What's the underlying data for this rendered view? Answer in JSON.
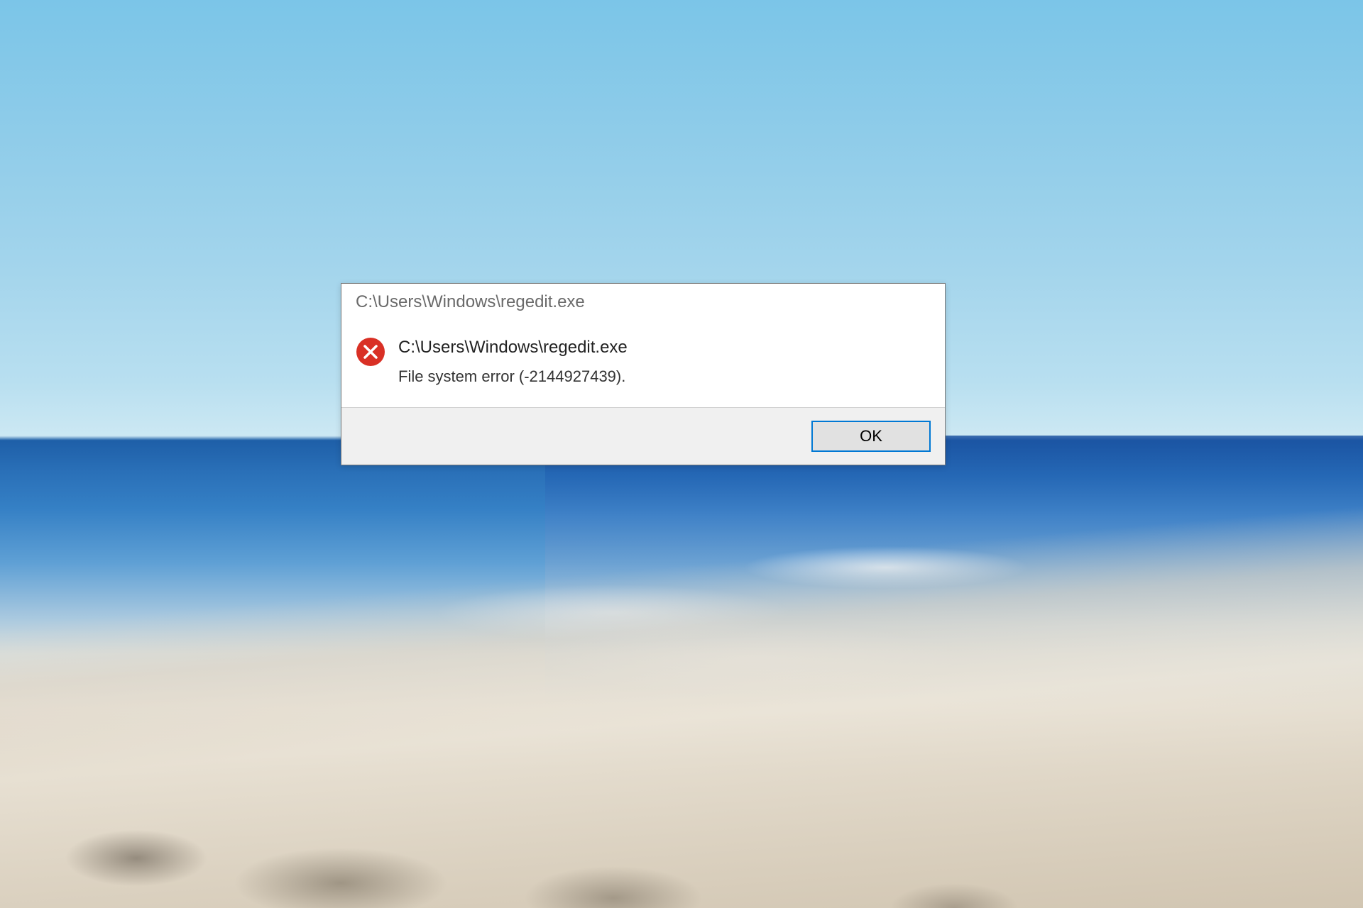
{
  "dialog": {
    "title": "C:\\Users\\Windows\\regedit.exe",
    "heading": "C:\\Users\\Windows\\regedit.exe",
    "message": "File system error (-2144927439).",
    "button_ok": "OK",
    "icon": "error-cross-icon",
    "colors": {
      "error_red": "#D93025",
      "button_border": "#0078d4"
    }
  }
}
